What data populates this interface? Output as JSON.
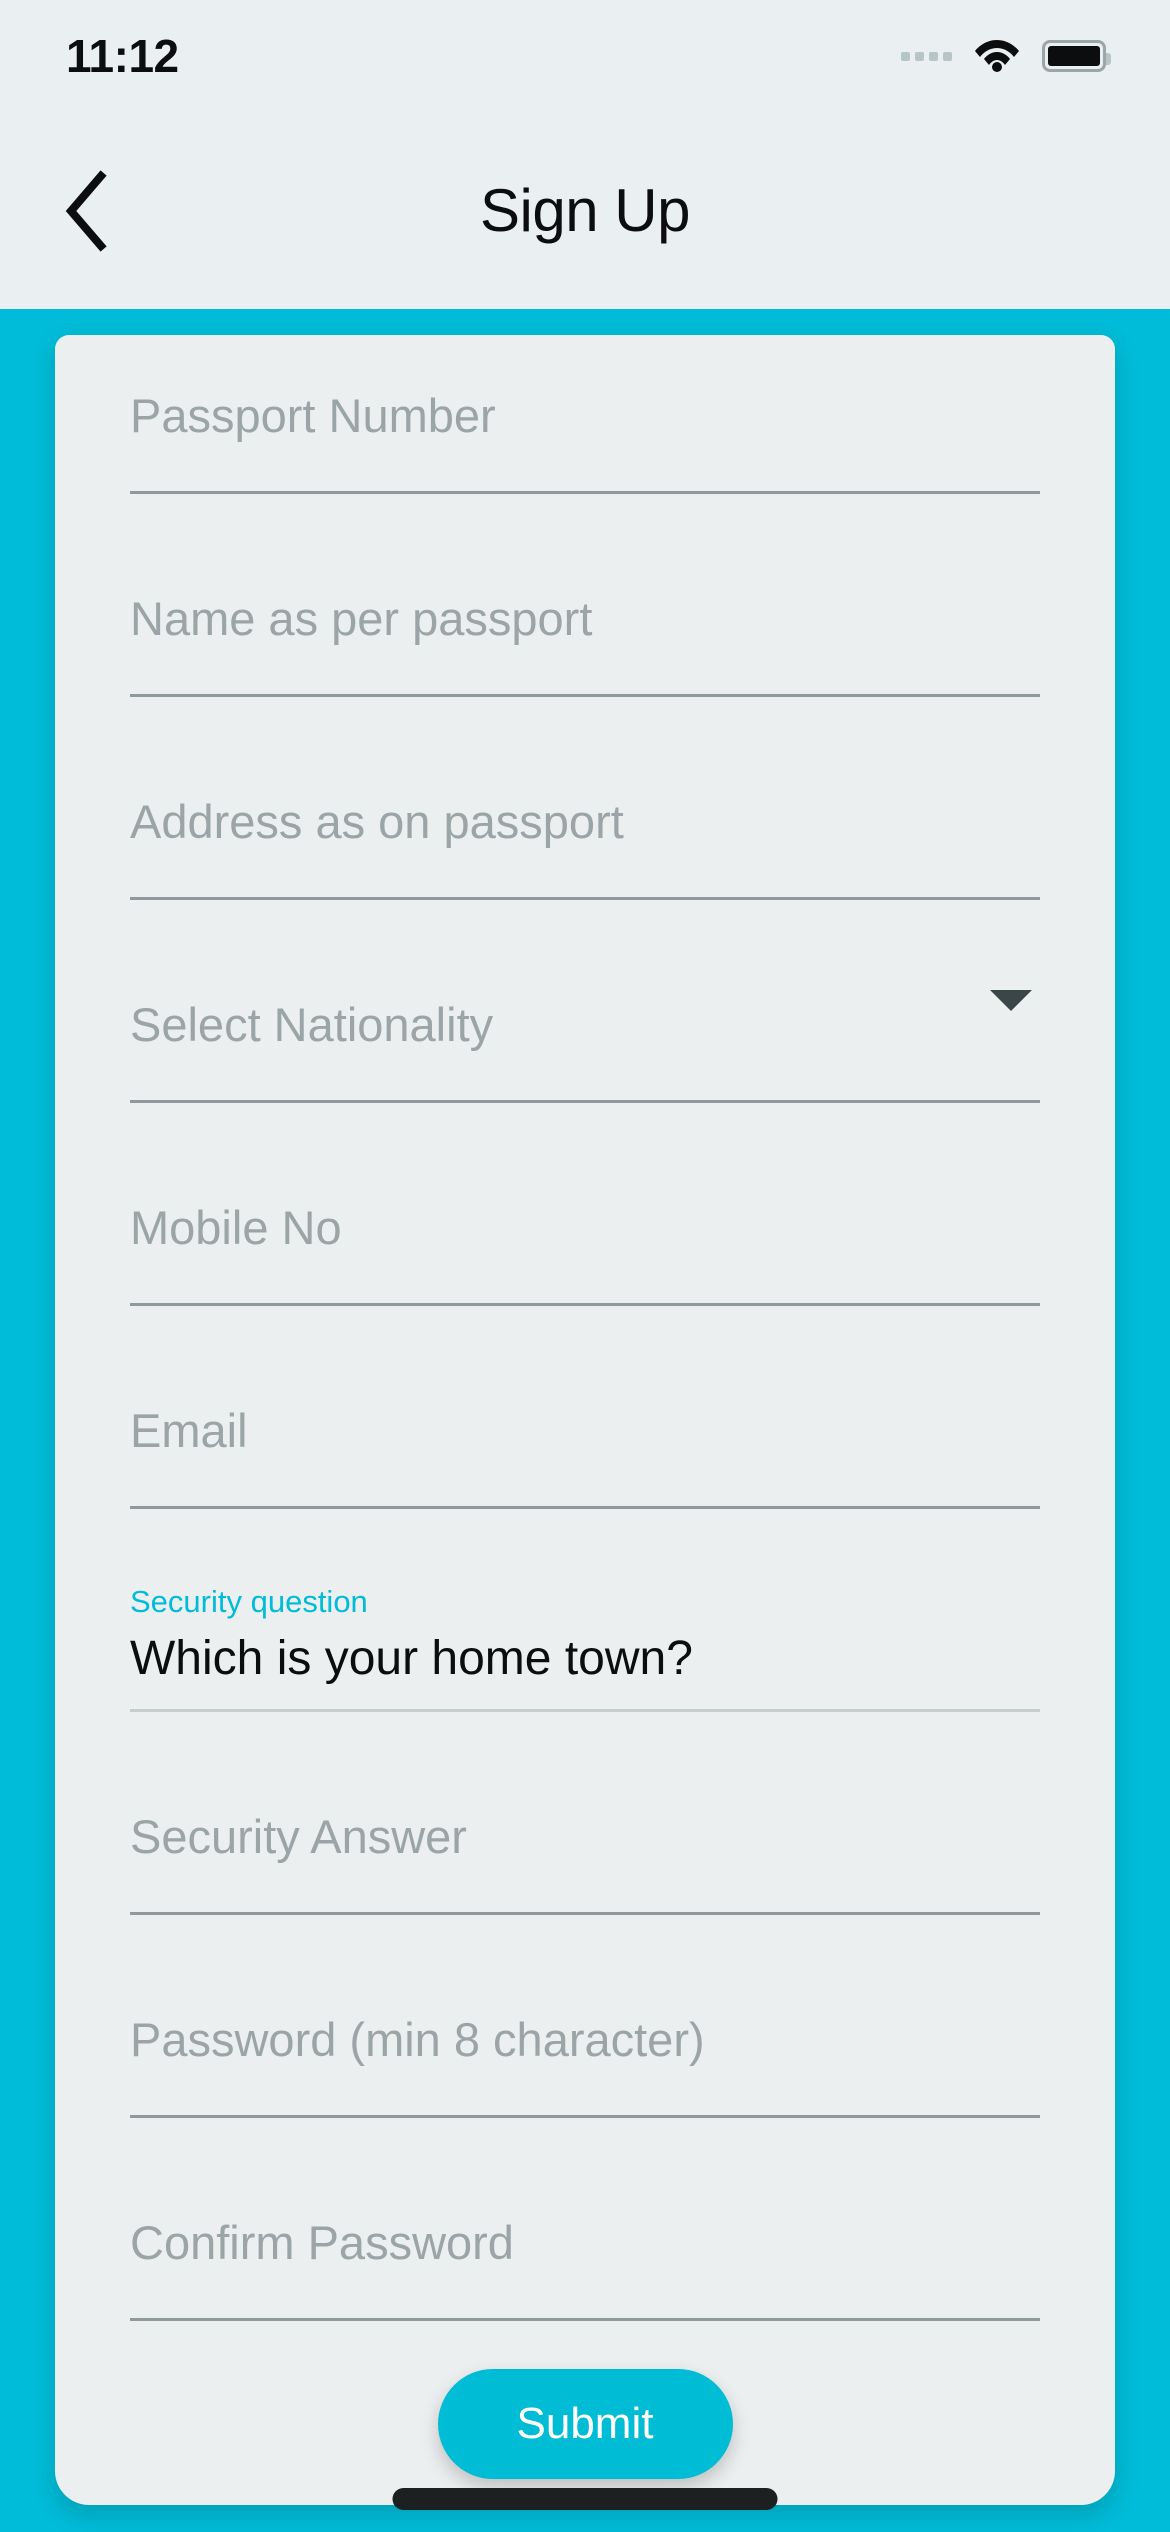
{
  "status_bar": {
    "time": "11:12",
    "signal_icon": "signal-dots-icon",
    "wifi_icon": "wifi-icon",
    "battery_icon": "battery-full-icon"
  },
  "header": {
    "back_icon": "chevron-left-icon",
    "title": "Sign Up"
  },
  "form": {
    "fields": [
      {
        "name": "passport-number",
        "placeholder": "Passport Number",
        "type": "text"
      },
      {
        "name": "name-as-passport",
        "placeholder": "Name as per passport",
        "type": "text"
      },
      {
        "name": "address-passport",
        "placeholder": "Address as on passport",
        "type": "text"
      },
      {
        "name": "nationality",
        "placeholder": "Select Nationality",
        "type": "select",
        "caret_icon": "chevron-down-icon"
      },
      {
        "name": "mobile-no",
        "placeholder": "Mobile No",
        "type": "tel"
      },
      {
        "name": "email",
        "placeholder": "Email",
        "type": "email"
      },
      {
        "name": "security-answer",
        "placeholder": "Security Answer",
        "type": "text"
      },
      {
        "name": "password",
        "placeholder": "Password (min 8 character)",
        "type": "password"
      },
      {
        "name": "confirm-password",
        "placeholder": "Confirm Password",
        "type": "password"
      }
    ],
    "security_question": {
      "label": "Security question",
      "value": "Which is your home town?"
    },
    "submit_label": "Submit"
  },
  "colors": {
    "accent": "#00bcd4",
    "background": "#00bcd8",
    "card": "#eceff0",
    "chrome": "#eaf0f1",
    "placeholder": "#9ba5a7",
    "rule": "#8f999b",
    "text": "#0b0d0e"
  }
}
